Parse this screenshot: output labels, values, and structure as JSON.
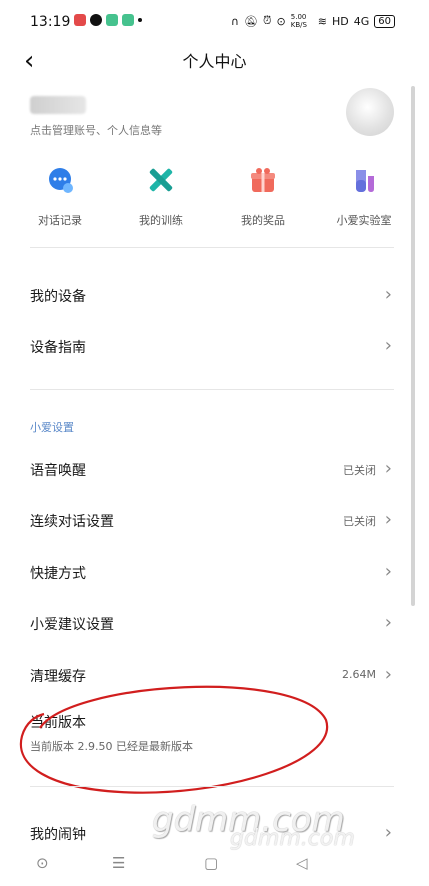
{
  "status_bar": {
    "time": "13:19",
    "net_speed": "5.00 KB/S",
    "hd": "HD",
    "signal": "4G",
    "battery": "60"
  },
  "nav": {
    "title": "个人中心"
  },
  "profile": {
    "hint": "点击管理账号、个人信息等"
  },
  "quick_actions": [
    {
      "label": "对话记录",
      "icon": "chat-bubble-icon"
    },
    {
      "label": "我的训练",
      "icon": "cross-icon"
    },
    {
      "label": "我的奖品",
      "icon": "gift-icon"
    },
    {
      "label": "小爱实验室",
      "icon": "lab-beaker-icon"
    }
  ],
  "menu": {
    "devices": "我的设备",
    "guide": "设备指南",
    "section_title": "小爱设置",
    "voice_wake": {
      "label": "语音唤醒",
      "value": "已关闭"
    },
    "continuous": {
      "label": "连续对话设置",
      "value": "已关闭"
    },
    "shortcut": "快捷方式",
    "suggest": "小爱建议设置",
    "cache": {
      "label": "清理缓存",
      "value": "2.64M"
    },
    "version": {
      "label": "当前版本",
      "detail": "当前版本 2.9.50 已经是最新版本"
    },
    "alarm": "我的闹钟"
  },
  "watermark": {
    "text": "gdmm.com"
  },
  "colors": {
    "accent": "#5a88c8",
    "annotation": "#d11e1e"
  }
}
